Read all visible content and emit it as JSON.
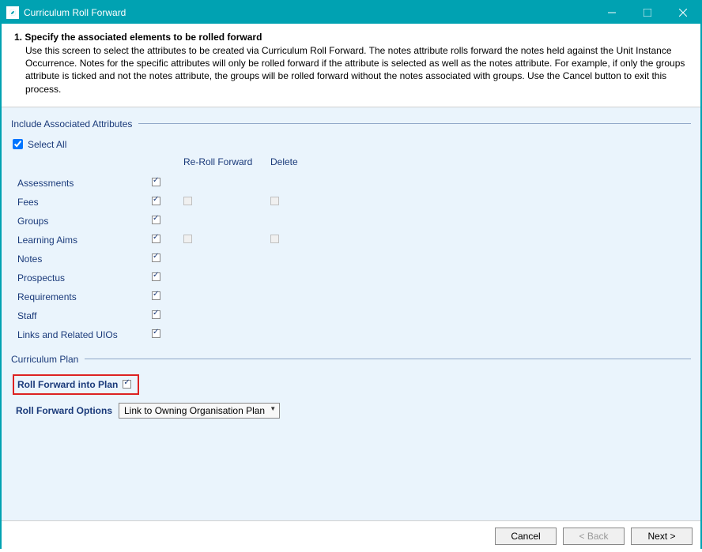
{
  "window": {
    "title": "Curriculum Roll Forward"
  },
  "header": {
    "title": "1. Specify the associated elements to be rolled forward",
    "description": "Use this screen to select the attributes to be created via Curriculum Roll Forward. The notes attribute rolls forward the notes held against the Unit Instance Occurrence. Notes for the specific attributes will only be rolled forward if the attribute is selected as well as the notes attribute. For example, if only the groups attribute is ticked and not the notes attribute, the groups will be rolled forward without the notes associated with groups. Use the Cancel button to exit this process."
  },
  "groups": {
    "attributes": {
      "label": "Include Associated Attributes",
      "select_all_label": "Select All",
      "headers": {
        "reroll": "Re-Roll Forward",
        "delete": "Delete"
      },
      "rows": [
        {
          "name": "Assessments",
          "checked": true,
          "reroll": null,
          "delete": null
        },
        {
          "name": "Fees",
          "checked": true,
          "reroll": false,
          "delete": false
        },
        {
          "name": "Groups",
          "checked": true,
          "reroll": null,
          "delete": null
        },
        {
          "name": "Learning Aims",
          "checked": true,
          "reroll": false,
          "delete": false
        },
        {
          "name": "Notes",
          "checked": true,
          "reroll": null,
          "delete": null
        },
        {
          "name": "Prospectus",
          "checked": true,
          "reroll": null,
          "delete": null
        },
        {
          "name": "Requirements",
          "checked": true,
          "reroll": null,
          "delete": null
        },
        {
          "name": "Staff",
          "checked": true,
          "reroll": null,
          "delete": null
        },
        {
          "name": "Links and Related UIOs",
          "checked": true,
          "reroll": null,
          "delete": null
        }
      ]
    },
    "plan": {
      "label": "Curriculum Plan",
      "roll_into_plan_label": "Roll Forward into Plan",
      "roll_into_plan_checked": true,
      "options_label": "Roll Forward Options",
      "options_selected": "Link to Owning Organisation Plan"
    }
  },
  "footer": {
    "cancel": "Cancel",
    "back": "< Back",
    "next": "Next >"
  }
}
